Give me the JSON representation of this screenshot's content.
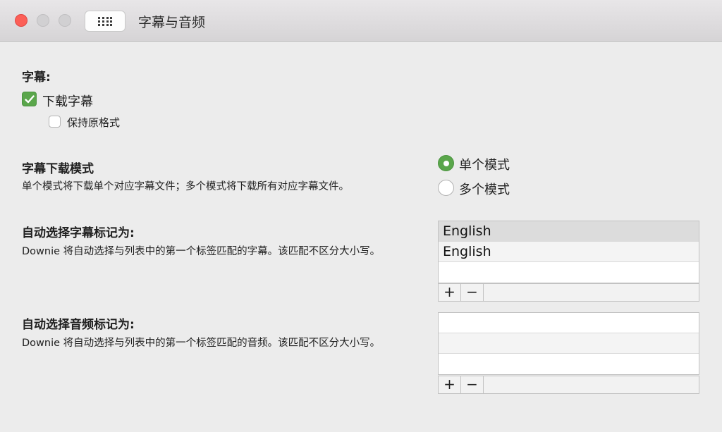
{
  "window": {
    "title": "字幕与音频"
  },
  "subtitles": {
    "heading": "字幕:",
    "download_label": "下载字幕",
    "download_checked": true,
    "keep_format_label": "保持原格式",
    "keep_format_checked": false
  },
  "mode": {
    "heading": "字幕下载模式",
    "description": "单个模式将下载单个对应字幕文件；多个模式将下载所有对应字幕文件。",
    "options": [
      {
        "label": "单个模式",
        "selected": true
      },
      {
        "label": "多个模式",
        "selected": false
      }
    ]
  },
  "auto_subtitle": {
    "heading": "自动选择字幕标记为:",
    "description": "Downie 将自动选择与列表中的第一个标签匹配的字幕。该匹配不区分大小写。",
    "tags": [
      "English",
      "English"
    ],
    "add_label": "+",
    "remove_label": "−"
  },
  "auto_audio": {
    "heading": "自动选择音频标记为:",
    "description": "Downie 将自动选择与列表中的第一个标签匹配的音频。该匹配不区分大小写。",
    "tags": [],
    "add_label": "+",
    "remove_label": "−"
  },
  "colors": {
    "accent_green": "#5aa64b",
    "close_red": "#fc5f57"
  },
  "icons": {
    "grid_button": "grid-icon",
    "checkmark": "checkmark-icon"
  }
}
